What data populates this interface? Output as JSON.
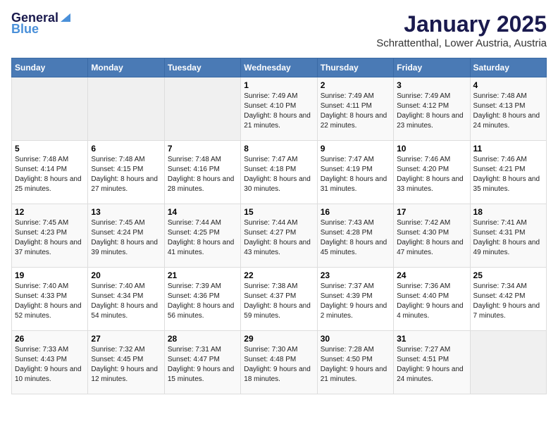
{
  "header": {
    "logo_line1": "General",
    "logo_line2": "Blue",
    "title": "January 2025",
    "subtitle": "Schrattenthal, Lower Austria, Austria"
  },
  "weekdays": [
    "Sunday",
    "Monday",
    "Tuesday",
    "Wednesday",
    "Thursday",
    "Friday",
    "Saturday"
  ],
  "weeks": [
    [
      {
        "day": "",
        "info": ""
      },
      {
        "day": "",
        "info": ""
      },
      {
        "day": "",
        "info": ""
      },
      {
        "day": "1",
        "info": "Sunrise: 7:49 AM\nSunset: 4:10 PM\nDaylight: 8 hours and 21 minutes."
      },
      {
        "day": "2",
        "info": "Sunrise: 7:49 AM\nSunset: 4:11 PM\nDaylight: 8 hours and 22 minutes."
      },
      {
        "day": "3",
        "info": "Sunrise: 7:49 AM\nSunset: 4:12 PM\nDaylight: 8 hours and 23 minutes."
      },
      {
        "day": "4",
        "info": "Sunrise: 7:48 AM\nSunset: 4:13 PM\nDaylight: 8 hours and 24 minutes."
      }
    ],
    [
      {
        "day": "5",
        "info": "Sunrise: 7:48 AM\nSunset: 4:14 PM\nDaylight: 8 hours and 25 minutes."
      },
      {
        "day": "6",
        "info": "Sunrise: 7:48 AM\nSunset: 4:15 PM\nDaylight: 8 hours and 27 minutes."
      },
      {
        "day": "7",
        "info": "Sunrise: 7:48 AM\nSunset: 4:16 PM\nDaylight: 8 hours and 28 minutes."
      },
      {
        "day": "8",
        "info": "Sunrise: 7:47 AM\nSunset: 4:18 PM\nDaylight: 8 hours and 30 minutes."
      },
      {
        "day": "9",
        "info": "Sunrise: 7:47 AM\nSunset: 4:19 PM\nDaylight: 8 hours and 31 minutes."
      },
      {
        "day": "10",
        "info": "Sunrise: 7:46 AM\nSunset: 4:20 PM\nDaylight: 8 hours and 33 minutes."
      },
      {
        "day": "11",
        "info": "Sunrise: 7:46 AM\nSunset: 4:21 PM\nDaylight: 8 hours and 35 minutes."
      }
    ],
    [
      {
        "day": "12",
        "info": "Sunrise: 7:45 AM\nSunset: 4:23 PM\nDaylight: 8 hours and 37 minutes."
      },
      {
        "day": "13",
        "info": "Sunrise: 7:45 AM\nSunset: 4:24 PM\nDaylight: 8 hours and 39 minutes."
      },
      {
        "day": "14",
        "info": "Sunrise: 7:44 AM\nSunset: 4:25 PM\nDaylight: 8 hours and 41 minutes."
      },
      {
        "day": "15",
        "info": "Sunrise: 7:44 AM\nSunset: 4:27 PM\nDaylight: 8 hours and 43 minutes."
      },
      {
        "day": "16",
        "info": "Sunrise: 7:43 AM\nSunset: 4:28 PM\nDaylight: 8 hours and 45 minutes."
      },
      {
        "day": "17",
        "info": "Sunrise: 7:42 AM\nSunset: 4:30 PM\nDaylight: 8 hours and 47 minutes."
      },
      {
        "day": "18",
        "info": "Sunrise: 7:41 AM\nSunset: 4:31 PM\nDaylight: 8 hours and 49 minutes."
      }
    ],
    [
      {
        "day": "19",
        "info": "Sunrise: 7:40 AM\nSunset: 4:33 PM\nDaylight: 8 hours and 52 minutes."
      },
      {
        "day": "20",
        "info": "Sunrise: 7:40 AM\nSunset: 4:34 PM\nDaylight: 8 hours and 54 minutes."
      },
      {
        "day": "21",
        "info": "Sunrise: 7:39 AM\nSunset: 4:36 PM\nDaylight: 8 hours and 56 minutes."
      },
      {
        "day": "22",
        "info": "Sunrise: 7:38 AM\nSunset: 4:37 PM\nDaylight: 8 hours and 59 minutes."
      },
      {
        "day": "23",
        "info": "Sunrise: 7:37 AM\nSunset: 4:39 PM\nDaylight: 9 hours and 2 minutes."
      },
      {
        "day": "24",
        "info": "Sunrise: 7:36 AM\nSunset: 4:40 PM\nDaylight: 9 hours and 4 minutes."
      },
      {
        "day": "25",
        "info": "Sunrise: 7:34 AM\nSunset: 4:42 PM\nDaylight: 9 hours and 7 minutes."
      }
    ],
    [
      {
        "day": "26",
        "info": "Sunrise: 7:33 AM\nSunset: 4:43 PM\nDaylight: 9 hours and 10 minutes."
      },
      {
        "day": "27",
        "info": "Sunrise: 7:32 AM\nSunset: 4:45 PM\nDaylight: 9 hours and 12 minutes."
      },
      {
        "day": "28",
        "info": "Sunrise: 7:31 AM\nSunset: 4:47 PM\nDaylight: 9 hours and 15 minutes."
      },
      {
        "day": "29",
        "info": "Sunrise: 7:30 AM\nSunset: 4:48 PM\nDaylight: 9 hours and 18 minutes."
      },
      {
        "day": "30",
        "info": "Sunrise: 7:28 AM\nSunset: 4:50 PM\nDaylight: 9 hours and 21 minutes."
      },
      {
        "day": "31",
        "info": "Sunrise: 7:27 AM\nSunset: 4:51 PM\nDaylight: 9 hours and 24 minutes."
      },
      {
        "day": "",
        "info": ""
      }
    ]
  ]
}
